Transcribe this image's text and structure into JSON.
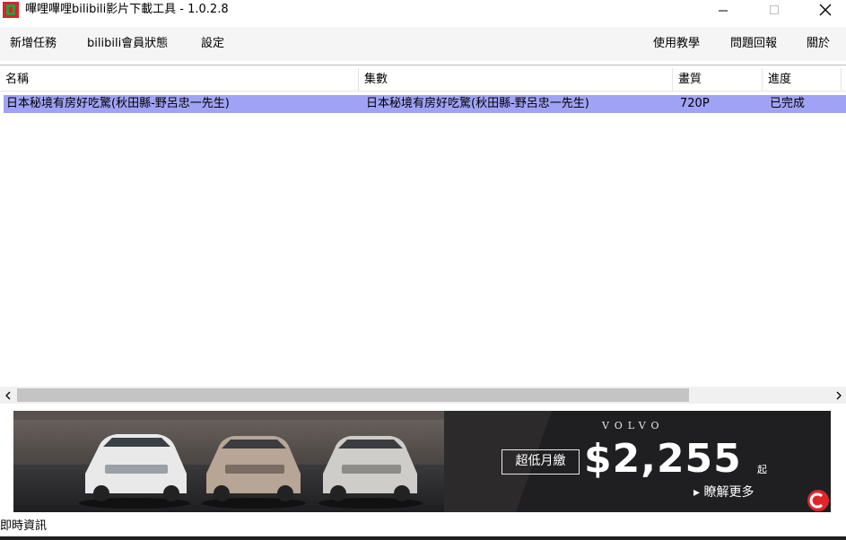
{
  "window": {
    "title": "嗶哩嗶哩bilibili影片下載工具 - 1.0.2.8"
  },
  "menu": {
    "left": [
      "新增任務",
      "bilibili會員狀態",
      "設定"
    ],
    "right": [
      "使用教學",
      "問題回報",
      "關於"
    ]
  },
  "table": {
    "columns": [
      "名稱",
      "集數",
      "畫質",
      "進度"
    ],
    "rows": [
      [
        "日本秘境有房好吃驚(秋田縣-野呂忠一先生)",
        "日本秘境有房好吃驚(秋田縣-野呂忠一先生)",
        "720P",
        "已完成"
      ]
    ]
  },
  "ad": {
    "brand": "VOLVO",
    "label": "超低月繳",
    "price": "$2,255",
    "price_suffix": "起",
    "more": "▸ 瞭解更多"
  },
  "status": {
    "label": "即時資訊"
  },
  "colors": {
    "selected_row": "#a0a3f5",
    "app_icon_red": "#d8242d",
    "app_icon_green": "#2f9a3a"
  }
}
